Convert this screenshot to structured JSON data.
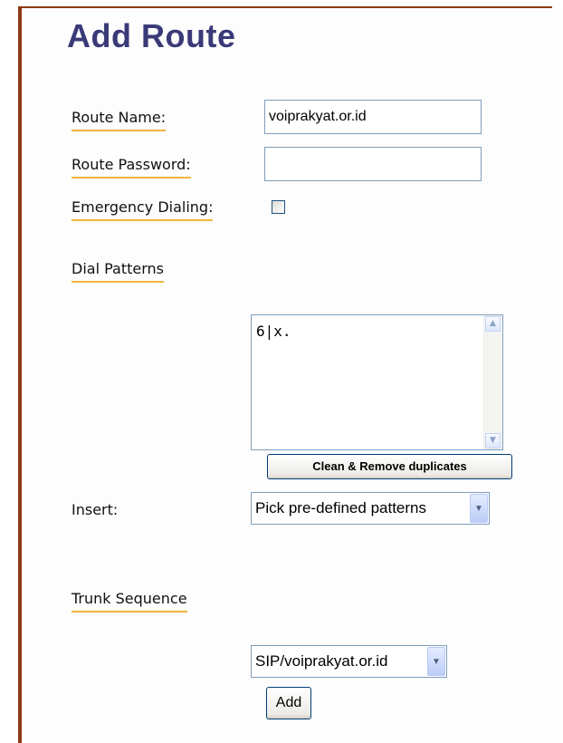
{
  "page": {
    "title": "Add Route"
  },
  "form": {
    "route_name_label": "Route Name:",
    "route_name_value": "voiprakyat.or.id",
    "route_password_label": "Route Password:",
    "route_password_value": "",
    "emergency_label": "Emergency Dialing:",
    "emergency_checked": false
  },
  "dial_patterns": {
    "heading": "Dial Patterns",
    "textarea_value": "6|x.",
    "clean_button_label": "Clean & Remove duplicates",
    "insert_label": "Insert:",
    "insert_select_value": "Pick pre-defined patterns"
  },
  "trunk": {
    "heading": "Trunk Sequence",
    "select_value": "SIP/voiprakyat.or.id",
    "add_button_label": "Add"
  },
  "icons": {
    "scroll_up": "scroll-up-arrow-icon",
    "scroll_down": "scroll-down-arrow-icon",
    "dropdown": "chevron-down-icon"
  },
  "colors": {
    "title": "#3a3a78",
    "underline": "#f2b43c",
    "frame": "#8b3b13"
  }
}
